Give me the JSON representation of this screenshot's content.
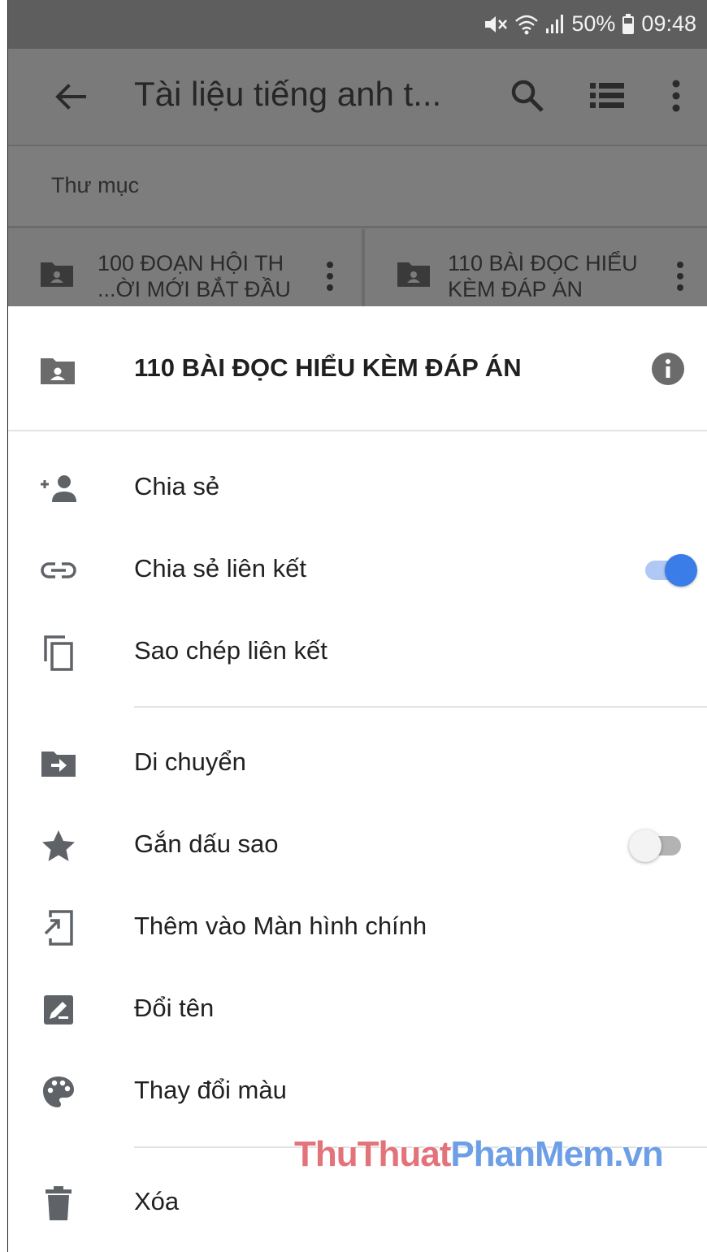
{
  "status_bar": {
    "battery": "50%",
    "time": "09:48"
  },
  "toolbar": {
    "title": "Tài liệu tiếng anh t..."
  },
  "section": {
    "label": "Thư mục"
  },
  "folders": [
    {
      "name": "100 ĐOẠN HỘI TH\n...ỜI MỚI BẮT ĐẦU"
    },
    {
      "name": "110 BÀI ĐỌC HIỂU\nKÈM ĐÁP ÁN"
    }
  ],
  "sheet": {
    "title": "110 BÀI ĐỌC HIỂU KÈM ĐÁP ÁN",
    "items": [
      {
        "label": "Chia sẻ",
        "icon": "add-person-icon"
      },
      {
        "label": "Chia sẻ liên kết",
        "icon": "link-icon",
        "toggle": true
      },
      {
        "label": "Sao chép liên kết",
        "icon": "copy-icon"
      },
      {
        "label": "Di chuyển",
        "icon": "move-folder-icon"
      },
      {
        "label": "Gắn dấu sao",
        "icon": "star-icon",
        "toggle": false
      },
      {
        "label": "Thêm vào Màn hình chính",
        "icon": "add-to-home-icon"
      },
      {
        "label": "Đổi tên",
        "icon": "rename-icon"
      },
      {
        "label": "Thay đổi màu",
        "icon": "palette-icon"
      },
      {
        "label": "Xóa",
        "icon": "trash-icon"
      }
    ]
  },
  "watermark": {
    "part1": "ThuThuat",
    "part2": "PhanMem.vn"
  },
  "colors": {
    "accent": "#3a7ce8",
    "icon": "#5f6368",
    "scrim": "#7b7b7b"
  }
}
